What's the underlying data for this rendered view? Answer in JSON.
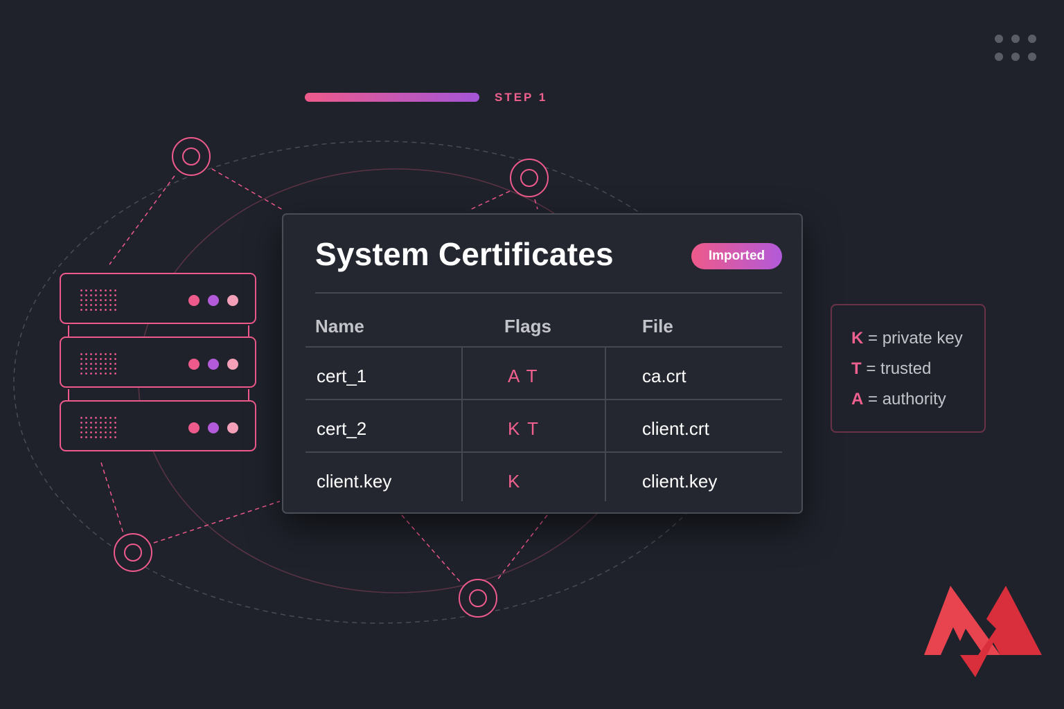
{
  "step": {
    "label": "STEP 1"
  },
  "card": {
    "title": "System Certificates",
    "badge": "Imported",
    "columns": {
      "name": "Name",
      "flags": "Flags",
      "file": "File"
    },
    "rows": [
      {
        "name": "cert_1",
        "flags": "A T",
        "file": "ca.crt"
      },
      {
        "name": "cert_2",
        "flags": "K T",
        "file": "client.crt"
      },
      {
        "name": "client.key",
        "flags": "K",
        "file": "client.key"
      }
    ]
  },
  "legend": [
    {
      "key": "K",
      "text": "= private key"
    },
    {
      "key": "T",
      "text": "= trusted"
    },
    {
      "key": "A",
      "text": "= authority"
    }
  ],
  "colors": {
    "background": "#1f222b",
    "accent_pink": "#ef5a8c",
    "accent_purple": "#b25ad9",
    "logo_red": "#e84450"
  },
  "icons": [
    "server-stack-icon",
    "network-node-icon",
    "grid-dots-icon",
    "brand-logo-icon"
  ]
}
